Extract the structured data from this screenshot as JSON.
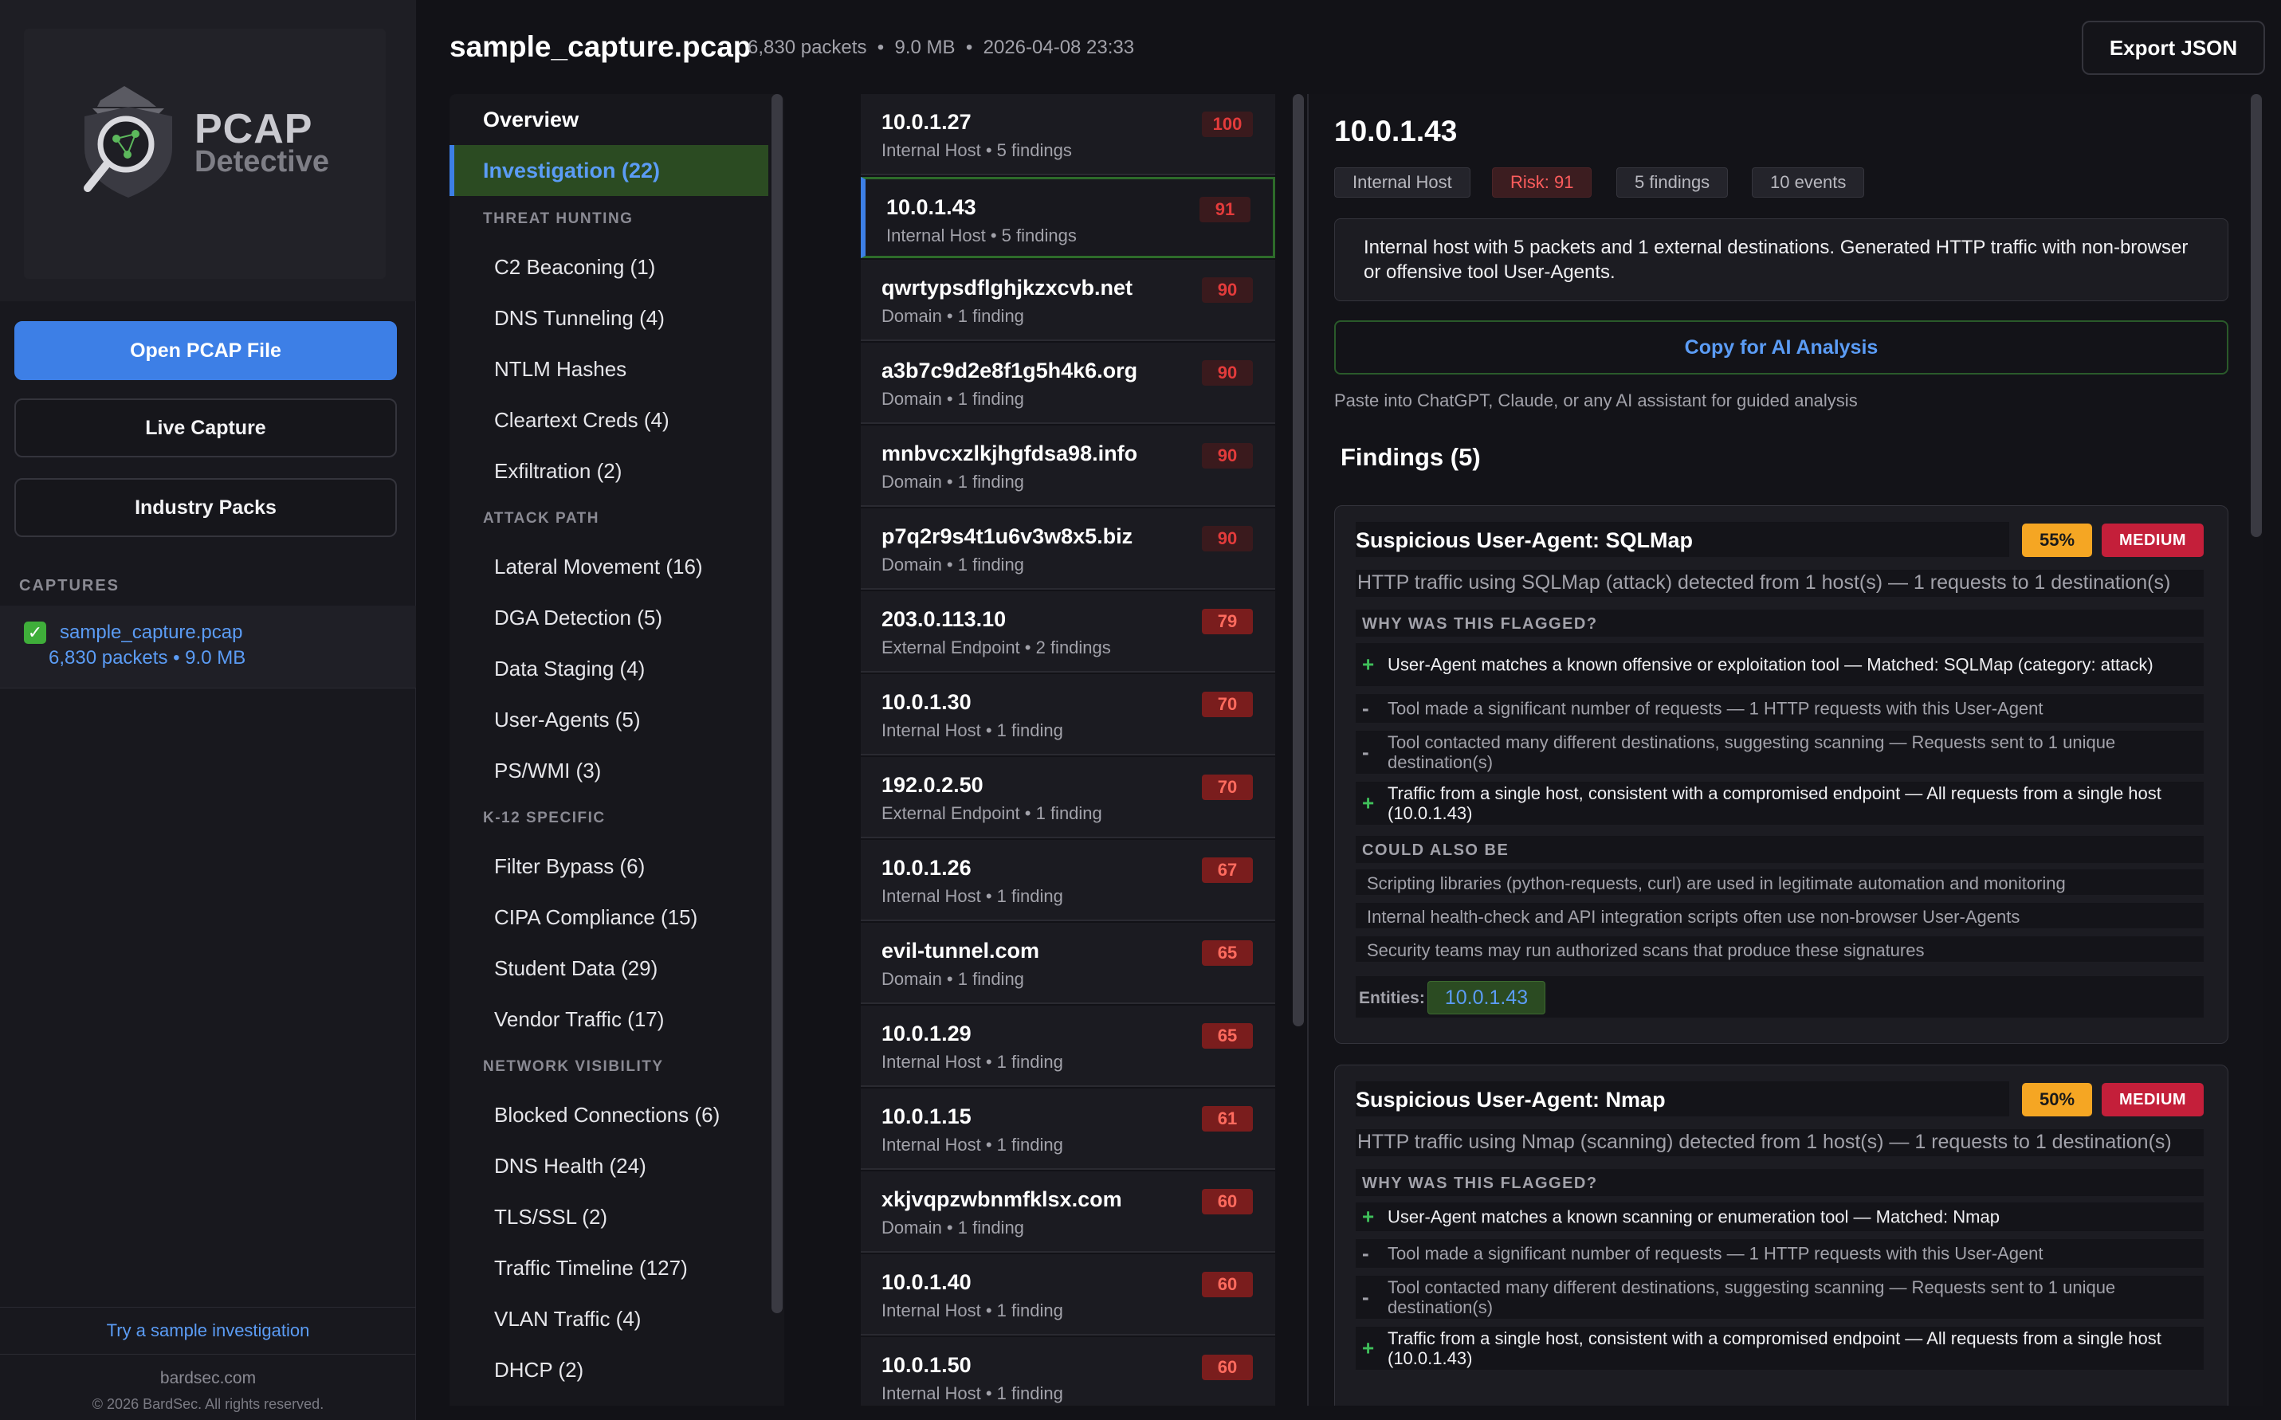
{
  "sidebar": {
    "logo": {
      "word1": "PCAP",
      "word2": "Detective"
    },
    "open_button": "Open PCAP File",
    "live_button": "Live Capture",
    "packs_button": "Industry Packs",
    "captures_title": "CAPTURES",
    "capture": {
      "name": "sample_capture.pcap",
      "meta": "6,830 packets • 9.0 MB"
    },
    "sample_link": "Try a sample investigation",
    "footer_site": "bardsec.com",
    "footer_copy": "© 2026 BardSec. All rights reserved."
  },
  "header": {
    "file_title": "sample_capture.pcap",
    "meta": "6,830 packets  •  9.0 MB  •  2026-04-08 23:33",
    "export_button": "Export JSON"
  },
  "nav": {
    "overview": "Overview",
    "investigation": "Investigation (22)",
    "sections": [
      {
        "title": "THREAT HUNTING",
        "items": [
          "C2 Beaconing (1)",
          "DNS Tunneling (4)",
          "NTLM Hashes",
          "Cleartext Creds (4)",
          "Exfiltration (2)"
        ]
      },
      {
        "title": "ATTACK PATH",
        "items": [
          "Lateral Movement (16)",
          "DGA Detection (5)",
          "Data Staging (4)",
          "User-Agents (5)",
          "PS/WMI (3)"
        ]
      },
      {
        "title": "K-12 SPECIFIC",
        "items": [
          "Filter Bypass (6)",
          "CIPA Compliance (15)",
          "Student Data (29)",
          "Vendor Traffic (17)"
        ]
      },
      {
        "title": "NETWORK VISIBILITY",
        "items": [
          "Blocked Connections (6)",
          "DNS Health (24)",
          "TLS/SSL (2)",
          "Traffic Timeline (127)",
          "VLAN Traffic (4)",
          "DHCP (2)"
        ]
      }
    ]
  },
  "entities": [
    {
      "name": "10.0.1.27",
      "sub": "Internal Host • 5 findings",
      "score": "100",
      "level": "critical"
    },
    {
      "name": "10.0.1.43",
      "sub": "Internal Host • 5 findings",
      "score": "91",
      "level": "critical",
      "selected": true
    },
    {
      "name": "qwrtypsdflghjkzxcvb.net",
      "sub": "Domain • 1 finding",
      "score": "90",
      "level": "critical"
    },
    {
      "name": "a3b7c9d2e8f1g5h4k6.org",
      "sub": "Domain • 1 finding",
      "score": "90",
      "level": "critical"
    },
    {
      "name": "mnbvcxzlkjhgfdsa98.info",
      "sub": "Domain • 1 finding",
      "score": "90",
      "level": "critical"
    },
    {
      "name": "p7q2r9s4t1u6v3w8x5.biz",
      "sub": "Domain • 1 finding",
      "score": "90",
      "level": "critical"
    },
    {
      "name": "203.0.113.10",
      "sub": "External Endpoint • 2 findings",
      "score": "79",
      "level": "high"
    },
    {
      "name": "10.0.1.30",
      "sub": "Internal Host • 1 finding",
      "score": "70",
      "level": "high"
    },
    {
      "name": "192.0.2.50",
      "sub": "External Endpoint • 1 finding",
      "score": "70",
      "level": "high"
    },
    {
      "name": "10.0.1.26",
      "sub": "Internal Host • 1 finding",
      "score": "67",
      "level": "high"
    },
    {
      "name": "evil-tunnel.com",
      "sub": "Domain • 1 finding",
      "score": "65",
      "level": "high"
    },
    {
      "name": "10.0.1.29",
      "sub": "Internal Host • 1 finding",
      "score": "65",
      "level": "high"
    },
    {
      "name": "10.0.1.15",
      "sub": "Internal Host • 1 finding",
      "score": "61",
      "level": "high"
    },
    {
      "name": "xkjvqpzwbnmfklsx.com",
      "sub": "Domain • 1 finding",
      "score": "60",
      "level": "high"
    },
    {
      "name": "10.0.1.40",
      "sub": "Internal Host • 1 finding",
      "score": "60",
      "level": "high"
    },
    {
      "name": "10.0.1.50",
      "sub": "Internal Host • 1 finding",
      "score": "60",
      "level": "high"
    }
  ],
  "detail": {
    "title": "10.0.1.43",
    "tags": [
      "Internal Host",
      "Risk: 91",
      "5 findings",
      "10 events"
    ],
    "summary": "Internal host with 5 packets and 1 external destinations. Generated HTTP traffic with non-browser or offensive tool User-Agents.",
    "copy_button": "Copy for AI Analysis",
    "paste_hint": "Paste into ChatGPT, Claude, or any AI assistant for guided analysis",
    "findings_title": "Findings (5)",
    "why_label": "WHY WAS THIS FLAGGED?",
    "also_label": "COULD ALSO BE",
    "entities_label": "Entities:",
    "findings": [
      {
        "title": "Suspicious User-Agent: SQLMap",
        "confidence": "55%",
        "severity": "MEDIUM",
        "description": "HTTP traffic using SQLMap (attack) detected from 1 host(s) — 1 requests to 1 destination(s)",
        "reasons": [
          {
            "sign": "+",
            "text": "User-Agent matches a known offensive or exploitation tool — Matched: SQLMap (category: attack)"
          },
          {
            "sign": "-",
            "text": "Tool made a significant number of requests — 1 HTTP requests with this User-Agent"
          },
          {
            "sign": "-",
            "text": "Tool contacted many different destinations, suggesting scanning — Requests sent to 1 unique destination(s)"
          },
          {
            "sign": "+",
            "text": "Traffic from a single host, consistent with a compromised endpoint — All requests from a single host (10.0.1.43)"
          }
        ],
        "alternatives": [
          "Scripting libraries (python-requests, curl) are used in legitimate automation and monitoring",
          "Internal health-check and API integration scripts often use non-browser User-Agents",
          "Security teams may run authorized scans that produce these signatures"
        ],
        "entity": "10.0.1.43"
      },
      {
        "title": "Suspicious User-Agent: Nmap",
        "confidence": "50%",
        "severity": "MEDIUM",
        "description": "HTTP traffic using Nmap (scanning) detected from 1 host(s) — 1 requests to 1 destination(s)",
        "reasons": [
          {
            "sign": "+",
            "text": "User-Agent matches a known scanning or enumeration tool — Matched: Nmap"
          },
          {
            "sign": "-",
            "text": "Tool made a significant number of requests — 1 HTTP requests with this User-Agent"
          },
          {
            "sign": "-",
            "text": "Tool contacted many different destinations, suggesting scanning — Requests sent to 1 unique destination(s)"
          },
          {
            "sign": "+",
            "text": "Traffic from a single host, consistent with a compromised endpoint — All requests from a single host (10.0.1.43)"
          }
        ]
      }
    ]
  },
  "colors": {
    "accent": "#3d7fe6",
    "selected_bg": "#2b4b22",
    "critical": "#e33b3b",
    "medium": "#c41f3a",
    "confidence": "#f5a623"
  }
}
